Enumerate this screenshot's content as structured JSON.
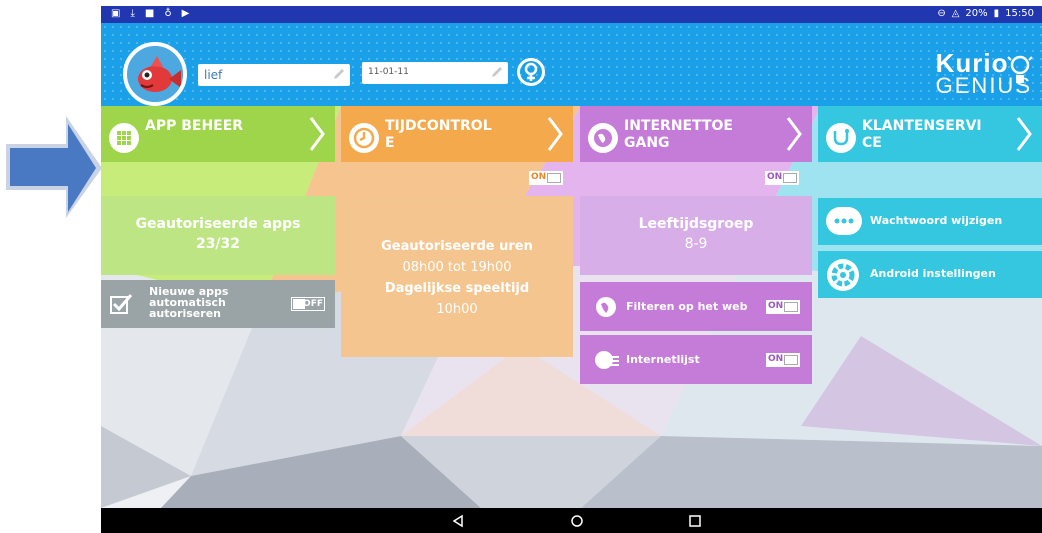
{
  "status_bar": {
    "battery": "20%",
    "time": "15:50"
  },
  "profile": {
    "name_value": "lief",
    "birthdate_value": "11-01-11"
  },
  "logo": {
    "line1": "Kurio",
    "line2": "GENIUS"
  },
  "tiles": {
    "app_beheer": {
      "title": "APP BEHEER",
      "panel_title": "Geautoriseerde apps",
      "panel_value": "23/32",
      "auto_label": "Nieuwe apps automatisch autoriseren",
      "auto_toggle": "OFF"
    },
    "tijdcontrole": {
      "title": "TIJDCONTROL E",
      "toggle": "ON",
      "hours_title": "Geautoriseerde uren",
      "hours_value": "08h00 tot 19h00",
      "play_title": "Dagelijkse speeltijd",
      "play_value": "10h00"
    },
    "internettoegang": {
      "title": "INTERNETTOE GANG",
      "toggle": "ON",
      "age_title": "Leeftijdsgroep",
      "age_value": "8-9",
      "filter_label": "Filteren op het web",
      "filter_toggle": "ON",
      "list_label": "Internetlijst",
      "list_toggle": "ON"
    },
    "klantenservice": {
      "title": "KLANTENSERVI CE",
      "password_label": "Wachtwoord wijzigen",
      "android_label": "Android instellingen"
    }
  },
  "colors": {
    "status_bar": "#2137b0",
    "header": "#1aa0e8",
    "green": "#9fd54a",
    "orange": "#f5a94d",
    "purple": "#c57cd9",
    "cyan": "#35c6e0",
    "gray": "#9aa4a6",
    "arrow": "#4a79c4"
  },
  "icons": {
    "app_beheer": "grid-icon",
    "tijdcontrole": "clock-icon",
    "internettoegang": "globe-icon",
    "klantenservice": "stethoscope-icon",
    "password": "dots-icon",
    "android": "gear-icon",
    "gender": "female-icon"
  }
}
